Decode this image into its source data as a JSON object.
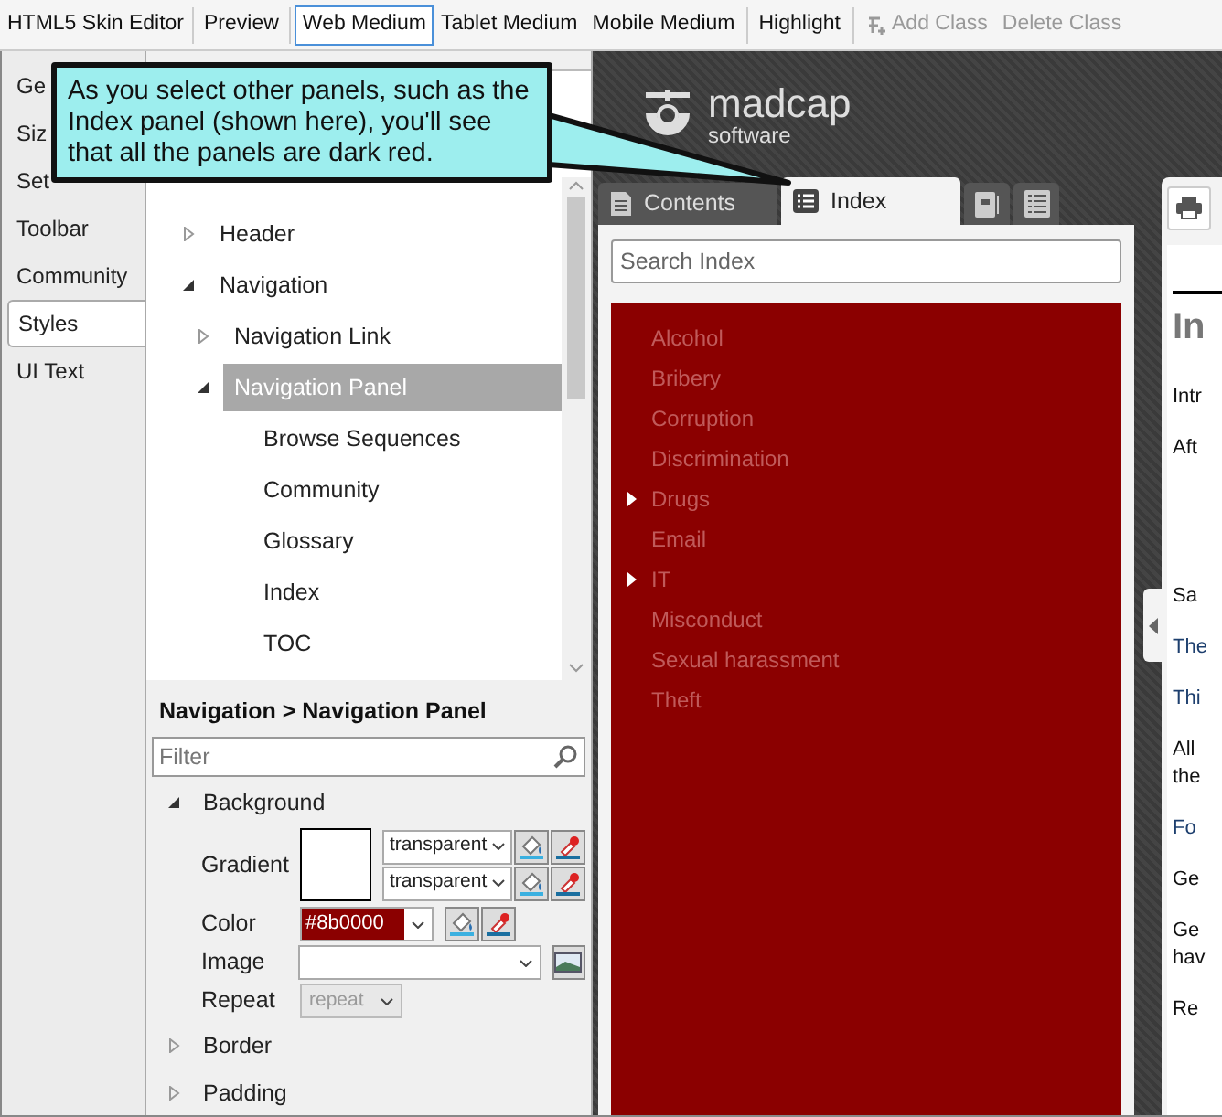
{
  "toolbar": {
    "title": "HTML5 Skin Editor",
    "items": [
      {
        "kind": "separator"
      },
      {
        "kind": "button",
        "label": "Preview",
        "selected": false,
        "disabled": false
      },
      {
        "kind": "separator"
      },
      {
        "kind": "button",
        "label": "Web Medium",
        "selected": true,
        "disabled": false
      },
      {
        "kind": "button",
        "label": "Tablet Medium",
        "selected": false,
        "disabled": false
      },
      {
        "kind": "button",
        "label": "Mobile Medium",
        "selected": false,
        "disabled": false
      },
      {
        "kind": "separator"
      },
      {
        "kind": "button",
        "label": "Highlight",
        "selected": false,
        "disabled": false
      },
      {
        "kind": "separator"
      },
      {
        "kind": "icon-button",
        "label": "Add Class",
        "selected": false,
        "disabled": true
      },
      {
        "kind": "button",
        "label": "Delete Class",
        "selected": false,
        "disabled": true
      }
    ]
  },
  "side_tabs": [
    {
      "label": "Ge",
      "selected": false
    },
    {
      "label": "Siz",
      "selected": false
    },
    {
      "label": "Set",
      "selected": false
    },
    {
      "label": "Toolbar",
      "selected": false
    },
    {
      "label": "Community",
      "selected": false
    },
    {
      "label": "Styles",
      "selected": true
    },
    {
      "label": "UI Text",
      "selected": false
    }
  ],
  "tree": [
    {
      "label": "Header",
      "expanded": false,
      "selected": false
    },
    {
      "label": "Navigation",
      "expanded": true,
      "selected": false,
      "children": [
        {
          "label": "Navigation Link",
          "expanded": false,
          "selected": false
        },
        {
          "label": "Navigation Panel",
          "expanded": true,
          "selected": true,
          "children": [
            {
              "label": "Browse Sequences",
              "selected": false
            },
            {
              "label": "Community",
              "selected": false
            },
            {
              "label": "Glossary",
              "selected": false
            },
            {
              "label": "Index",
              "selected": false
            },
            {
              "label": "TOC",
              "selected": false
            }
          ]
        }
      ]
    }
  ],
  "properties": {
    "breadcrumb": "Navigation > Navigation Panel",
    "filter": {
      "placeholder": "Filter"
    },
    "groups": [
      {
        "label": "Background",
        "expanded": true,
        "rows": [
          {
            "kind": "gradient",
            "label": "Gradient",
            "stops": [
              "transparent",
              "transparent"
            ]
          },
          {
            "kind": "color",
            "label": "Color",
            "value": "#8b0000",
            "color": "#8b0000"
          },
          {
            "kind": "image",
            "label": "Image"
          },
          {
            "kind": "select",
            "label": "Repeat",
            "value": "repeat",
            "disabled": true
          }
        ]
      },
      {
        "label": "Border",
        "expanded": false
      },
      {
        "label": "Padding",
        "expanded": false
      }
    ]
  },
  "preview": {
    "logo": {
      "name": "madcap",
      "tagline": "software"
    },
    "tabs": [
      {
        "kind": "text",
        "label": "Contents",
        "selected": false
      },
      {
        "kind": "text",
        "label": "Index",
        "selected": true
      },
      {
        "kind": "glossary",
        "selected": false
      },
      {
        "kind": "list",
        "selected": false
      }
    ],
    "search": {
      "placeholder": "Search Index"
    },
    "index_entries": [
      {
        "label": "Alcohol",
        "expandable": false
      },
      {
        "label": "Bribery",
        "expandable": false
      },
      {
        "label": "Corruption",
        "expandable": false
      },
      {
        "label": "Discrimination",
        "expandable": false
      },
      {
        "label": "Drugs",
        "expandable": true
      },
      {
        "label": "Email",
        "expandable": false
      },
      {
        "label": "IT",
        "expandable": true
      },
      {
        "label": "Misconduct",
        "expandable": false
      },
      {
        "label": "Sexual harassment",
        "expandable": false
      },
      {
        "label": "Theft",
        "expandable": false
      }
    ],
    "content": {
      "heading": "In",
      "paragraphs": [
        {
          "lines": [
            "Intr"
          ],
          "link": false
        },
        {
          "lines": [
            "Aft"
          ],
          "link": false
        },
        {
          "lines": [
            "Sa"
          ],
          "link": false
        },
        {
          "lines": [
            "The"
          ],
          "link": true
        },
        {
          "lines": [
            "Thi"
          ],
          "link": true
        },
        {
          "lines": [
            "All",
            "the"
          ],
          "link": false
        },
        {
          "lines": [
            "Fo"
          ],
          "link": true
        },
        {
          "lines": [
            "Ge"
          ],
          "link": false
        },
        {
          "lines": [
            "Ge",
            "hav"
          ],
          "link": false
        },
        {
          "lines": [
            "Re"
          ],
          "link": false
        }
      ]
    }
  },
  "callout": {
    "text": "As you select other panels, such as the Index panel (shown here), you'll see that all the panels are dark red."
  }
}
